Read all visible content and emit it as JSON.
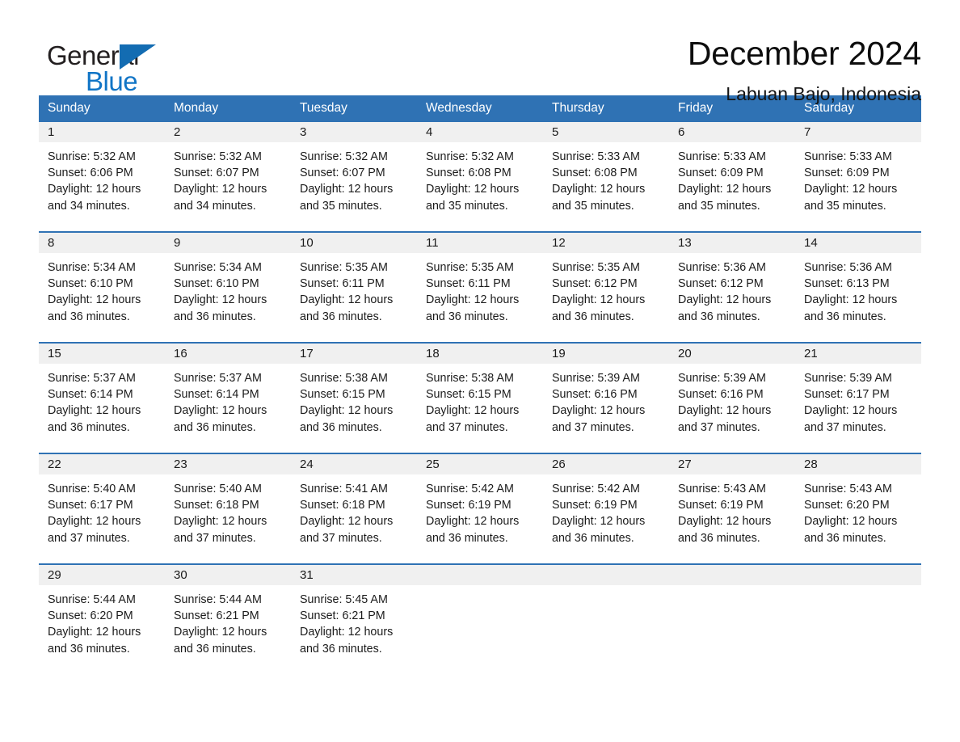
{
  "brand": {
    "name_part1": "General",
    "name_part2": "Blue",
    "accent_color": "#1175c6",
    "triangle_color": "#136cb2"
  },
  "header": {
    "title": "December 2024",
    "location": "Labuan Bajo, Indonesia"
  },
  "theme": {
    "header_blue": "#2f72b4",
    "date_band_gray": "#f0f0f0",
    "text_color": "#1b1b1b"
  },
  "weekdays": [
    "Sunday",
    "Monday",
    "Tuesday",
    "Wednesday",
    "Thursday",
    "Friday",
    "Saturday"
  ],
  "weeks": [
    {
      "days": [
        {
          "date": "1",
          "sunrise": "Sunrise: 5:32 AM",
          "sunset": "Sunset: 6:06 PM",
          "daylight_line1": "Daylight: 12 hours",
          "daylight_line2": "and 34 minutes."
        },
        {
          "date": "2",
          "sunrise": "Sunrise: 5:32 AM",
          "sunset": "Sunset: 6:07 PM",
          "daylight_line1": "Daylight: 12 hours",
          "daylight_line2": "and 34 minutes."
        },
        {
          "date": "3",
          "sunrise": "Sunrise: 5:32 AM",
          "sunset": "Sunset: 6:07 PM",
          "daylight_line1": "Daylight: 12 hours",
          "daylight_line2": "and 35 minutes."
        },
        {
          "date": "4",
          "sunrise": "Sunrise: 5:32 AM",
          "sunset": "Sunset: 6:08 PM",
          "daylight_line1": "Daylight: 12 hours",
          "daylight_line2": "and 35 minutes."
        },
        {
          "date": "5",
          "sunrise": "Sunrise: 5:33 AM",
          "sunset": "Sunset: 6:08 PM",
          "daylight_line1": "Daylight: 12 hours",
          "daylight_line2": "and 35 minutes."
        },
        {
          "date": "6",
          "sunrise": "Sunrise: 5:33 AM",
          "sunset": "Sunset: 6:09 PM",
          "daylight_line1": "Daylight: 12 hours",
          "daylight_line2": "and 35 minutes."
        },
        {
          "date": "7",
          "sunrise": "Sunrise: 5:33 AM",
          "sunset": "Sunset: 6:09 PM",
          "daylight_line1": "Daylight: 12 hours",
          "daylight_line2": "and 35 minutes."
        }
      ]
    },
    {
      "days": [
        {
          "date": "8",
          "sunrise": "Sunrise: 5:34 AM",
          "sunset": "Sunset: 6:10 PM",
          "daylight_line1": "Daylight: 12 hours",
          "daylight_line2": "and 36 minutes."
        },
        {
          "date": "9",
          "sunrise": "Sunrise: 5:34 AM",
          "sunset": "Sunset: 6:10 PM",
          "daylight_line1": "Daylight: 12 hours",
          "daylight_line2": "and 36 minutes."
        },
        {
          "date": "10",
          "sunrise": "Sunrise: 5:35 AM",
          "sunset": "Sunset: 6:11 PM",
          "daylight_line1": "Daylight: 12 hours",
          "daylight_line2": "and 36 minutes."
        },
        {
          "date": "11",
          "sunrise": "Sunrise: 5:35 AM",
          "sunset": "Sunset: 6:11 PM",
          "daylight_line1": "Daylight: 12 hours",
          "daylight_line2": "and 36 minutes."
        },
        {
          "date": "12",
          "sunrise": "Sunrise: 5:35 AM",
          "sunset": "Sunset: 6:12 PM",
          "daylight_line1": "Daylight: 12 hours",
          "daylight_line2": "and 36 minutes."
        },
        {
          "date": "13",
          "sunrise": "Sunrise: 5:36 AM",
          "sunset": "Sunset: 6:12 PM",
          "daylight_line1": "Daylight: 12 hours",
          "daylight_line2": "and 36 minutes."
        },
        {
          "date": "14",
          "sunrise": "Sunrise: 5:36 AM",
          "sunset": "Sunset: 6:13 PM",
          "daylight_line1": "Daylight: 12 hours",
          "daylight_line2": "and 36 minutes."
        }
      ]
    },
    {
      "days": [
        {
          "date": "15",
          "sunrise": "Sunrise: 5:37 AM",
          "sunset": "Sunset: 6:14 PM",
          "daylight_line1": "Daylight: 12 hours",
          "daylight_line2": "and 36 minutes."
        },
        {
          "date": "16",
          "sunrise": "Sunrise: 5:37 AM",
          "sunset": "Sunset: 6:14 PM",
          "daylight_line1": "Daylight: 12 hours",
          "daylight_line2": "and 36 minutes."
        },
        {
          "date": "17",
          "sunrise": "Sunrise: 5:38 AM",
          "sunset": "Sunset: 6:15 PM",
          "daylight_line1": "Daylight: 12 hours",
          "daylight_line2": "and 36 minutes."
        },
        {
          "date": "18",
          "sunrise": "Sunrise: 5:38 AM",
          "sunset": "Sunset: 6:15 PM",
          "daylight_line1": "Daylight: 12 hours",
          "daylight_line2": "and 37 minutes."
        },
        {
          "date": "19",
          "sunrise": "Sunrise: 5:39 AM",
          "sunset": "Sunset: 6:16 PM",
          "daylight_line1": "Daylight: 12 hours",
          "daylight_line2": "and 37 minutes."
        },
        {
          "date": "20",
          "sunrise": "Sunrise: 5:39 AM",
          "sunset": "Sunset: 6:16 PM",
          "daylight_line1": "Daylight: 12 hours",
          "daylight_line2": "and 37 minutes."
        },
        {
          "date": "21",
          "sunrise": "Sunrise: 5:39 AM",
          "sunset": "Sunset: 6:17 PM",
          "daylight_line1": "Daylight: 12 hours",
          "daylight_line2": "and 37 minutes."
        }
      ]
    },
    {
      "days": [
        {
          "date": "22",
          "sunrise": "Sunrise: 5:40 AM",
          "sunset": "Sunset: 6:17 PM",
          "daylight_line1": "Daylight: 12 hours",
          "daylight_line2": "and 37 minutes."
        },
        {
          "date": "23",
          "sunrise": "Sunrise: 5:40 AM",
          "sunset": "Sunset: 6:18 PM",
          "daylight_line1": "Daylight: 12 hours",
          "daylight_line2": "and 37 minutes."
        },
        {
          "date": "24",
          "sunrise": "Sunrise: 5:41 AM",
          "sunset": "Sunset: 6:18 PM",
          "daylight_line1": "Daylight: 12 hours",
          "daylight_line2": "and 37 minutes."
        },
        {
          "date": "25",
          "sunrise": "Sunrise: 5:42 AM",
          "sunset": "Sunset: 6:19 PM",
          "daylight_line1": "Daylight: 12 hours",
          "daylight_line2": "and 36 minutes."
        },
        {
          "date": "26",
          "sunrise": "Sunrise: 5:42 AM",
          "sunset": "Sunset: 6:19 PM",
          "daylight_line1": "Daylight: 12 hours",
          "daylight_line2": "and 36 minutes."
        },
        {
          "date": "27",
          "sunrise": "Sunrise: 5:43 AM",
          "sunset": "Sunset: 6:19 PM",
          "daylight_line1": "Daylight: 12 hours",
          "daylight_line2": "and 36 minutes."
        },
        {
          "date": "28",
          "sunrise": "Sunrise: 5:43 AM",
          "sunset": "Sunset: 6:20 PM",
          "daylight_line1": "Daylight: 12 hours",
          "daylight_line2": "and 36 minutes."
        }
      ]
    },
    {
      "days": [
        {
          "date": "29",
          "sunrise": "Sunrise: 5:44 AM",
          "sunset": "Sunset: 6:20 PM",
          "daylight_line1": "Daylight: 12 hours",
          "daylight_line2": "and 36 minutes."
        },
        {
          "date": "30",
          "sunrise": "Sunrise: 5:44 AM",
          "sunset": "Sunset: 6:21 PM",
          "daylight_line1": "Daylight: 12 hours",
          "daylight_line2": "and 36 minutes."
        },
        {
          "date": "31",
          "sunrise": "Sunrise: 5:45 AM",
          "sunset": "Sunset: 6:21 PM",
          "daylight_line1": "Daylight: 12 hours",
          "daylight_line2": "and 36 minutes."
        },
        {
          "date": "",
          "sunrise": "",
          "sunset": "",
          "daylight_line1": "",
          "daylight_line2": ""
        },
        {
          "date": "",
          "sunrise": "",
          "sunset": "",
          "daylight_line1": "",
          "daylight_line2": ""
        },
        {
          "date": "",
          "sunrise": "",
          "sunset": "",
          "daylight_line1": "",
          "daylight_line2": ""
        },
        {
          "date": "",
          "sunrise": "",
          "sunset": "",
          "daylight_line1": "",
          "daylight_line2": ""
        }
      ]
    }
  ]
}
